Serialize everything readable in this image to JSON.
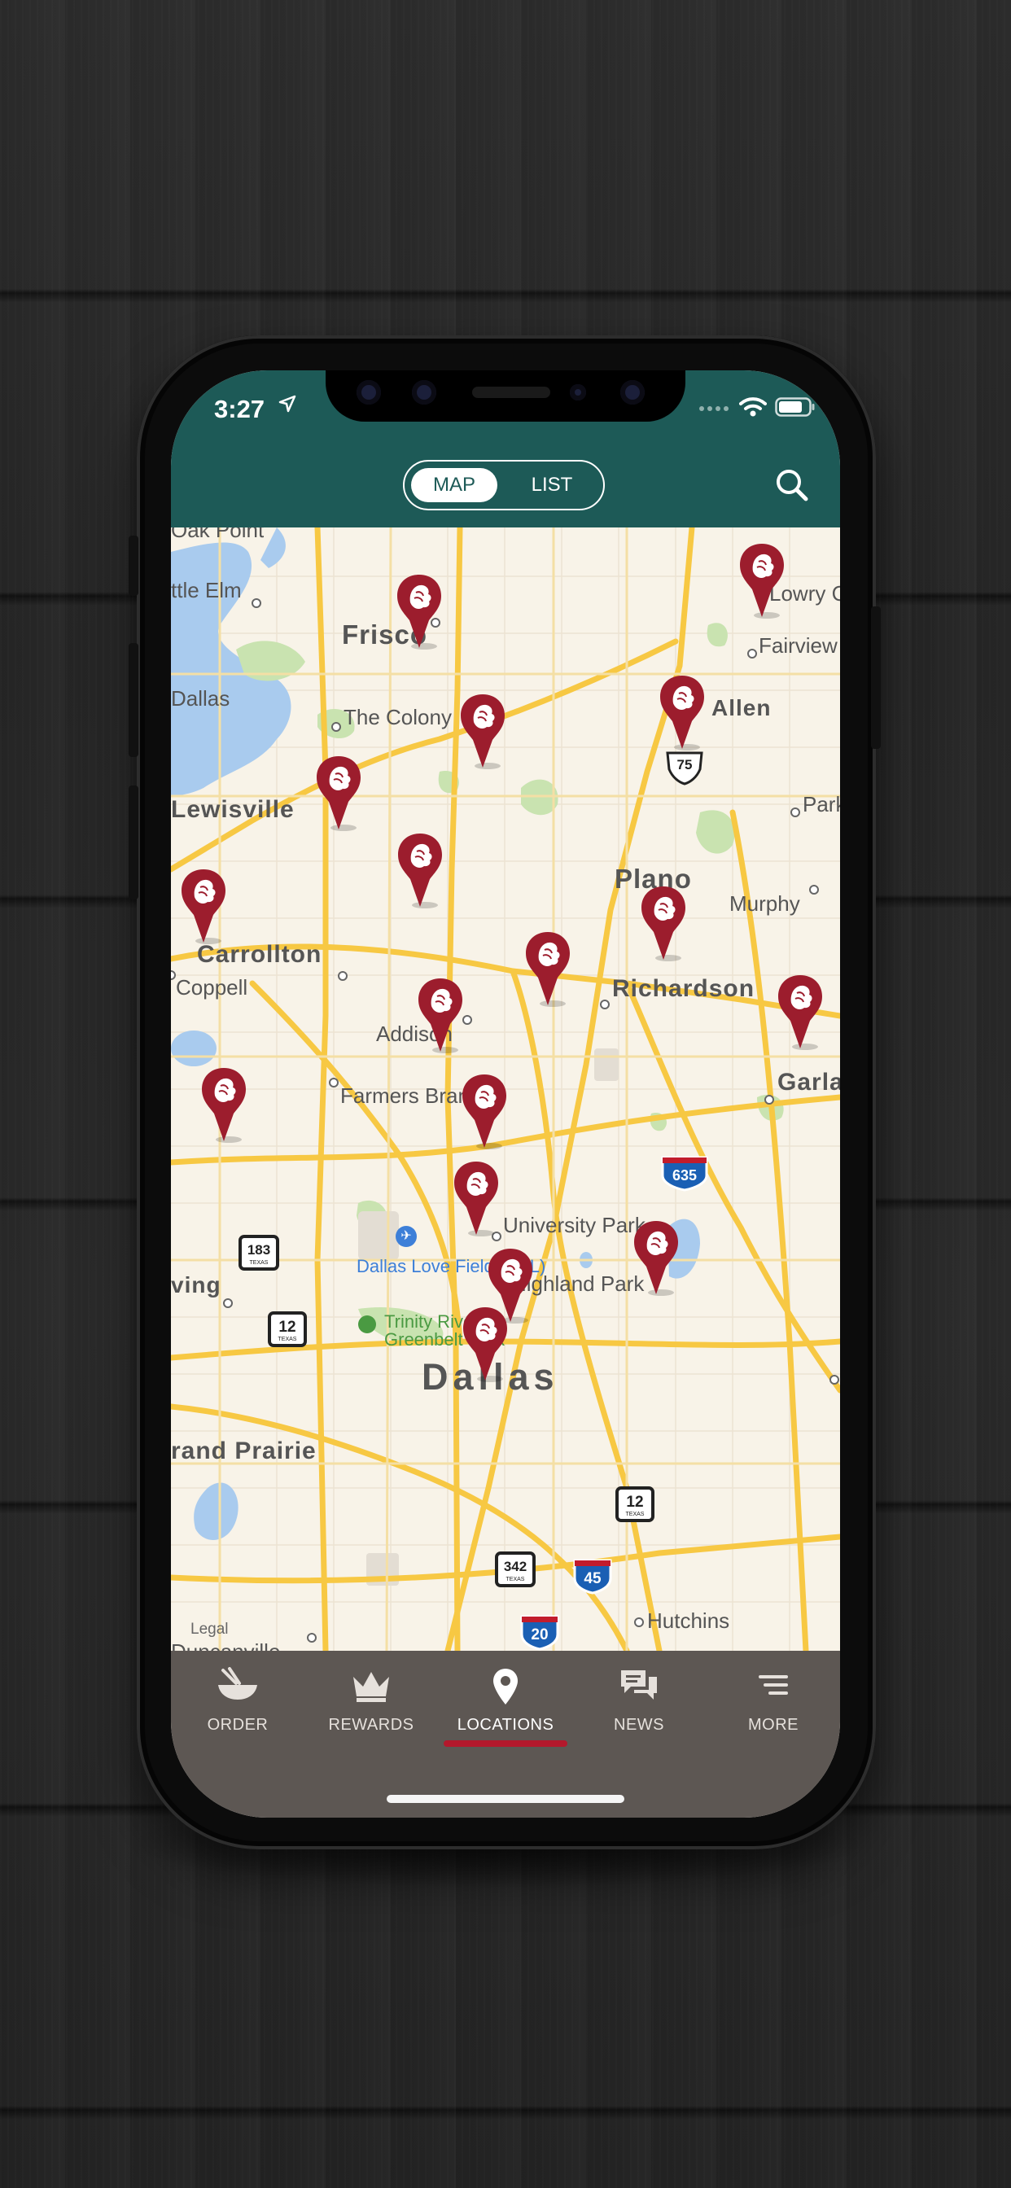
{
  "status_bar": {
    "time": "3:27",
    "location_icon": "location-arrow-icon",
    "signal_icon": "cellular-signal-icon",
    "wifi_icon": "wifi-icon",
    "battery_icon": "battery-icon"
  },
  "header": {
    "segmented": {
      "map_label": "MAP",
      "list_label": "LIST",
      "selected": "MAP"
    },
    "search_icon": "search-icon"
  },
  "map": {
    "places": {
      "oak_point": "Oak Point",
      "little_elm": "ttle Elm",
      "lowry": "Lowry C",
      "frisco": "Frisco",
      "fairview": "Fairview",
      "dallas_edge": "Dallas",
      "the_colony": "The Colony",
      "allen": "Allen",
      "lewisville": "Lewisville",
      "park": "Park",
      "plano": "Plano",
      "murphy": "Murphy",
      "carrollton": "Carrollton",
      "coppell": "Coppell",
      "richardson": "Richardson",
      "addison": "Addison",
      "garland": "Garla",
      "farmers_branch": "Farmers Branch",
      "university_park": "University Park",
      "love_field": "Dallas Love Field (DAL)",
      "irving": "ving",
      "highland_park": "Highland Park",
      "trinity": "Trinity River Greenbelt Park",
      "dallas": "Dallas",
      "grand_prairie": "rand Prairie",
      "hutchins": "Hutchins",
      "duncanville": "Duncanville",
      "legal": "Legal"
    },
    "shields": {
      "us75": "75",
      "i635": "635",
      "tx183": "183",
      "tx12_west": "12",
      "tx12_south": "12",
      "tx342": "342",
      "i45": "45",
      "i20": "20"
    },
    "pin_icon": "restaurant-location-pin-icon",
    "pin_count": 17,
    "locate_icon": "locate-me-crosshair-icon"
  },
  "tabs": [
    {
      "label": "ORDER",
      "icon": "bowl-order-icon",
      "active": false
    },
    {
      "label": "REWARDS",
      "icon": "crown-rewards-icon",
      "active": false
    },
    {
      "label": "LOCATIONS",
      "icon": "location-pin-icon",
      "active": true
    },
    {
      "label": "NEWS",
      "icon": "chat-bubbles-news-icon",
      "active": false
    },
    {
      "label": "MORE",
      "icon": "menu-lines-more-icon",
      "active": false
    }
  ],
  "colors": {
    "header": "#1d5a57",
    "pin": "#9c1d2d",
    "tabbar": "#5d5753",
    "active_underline": "#b3182c",
    "map_bg": "#f8f3e8",
    "road": "#f7c843",
    "water": "#a9cbee",
    "park": "#c9e3b0"
  }
}
